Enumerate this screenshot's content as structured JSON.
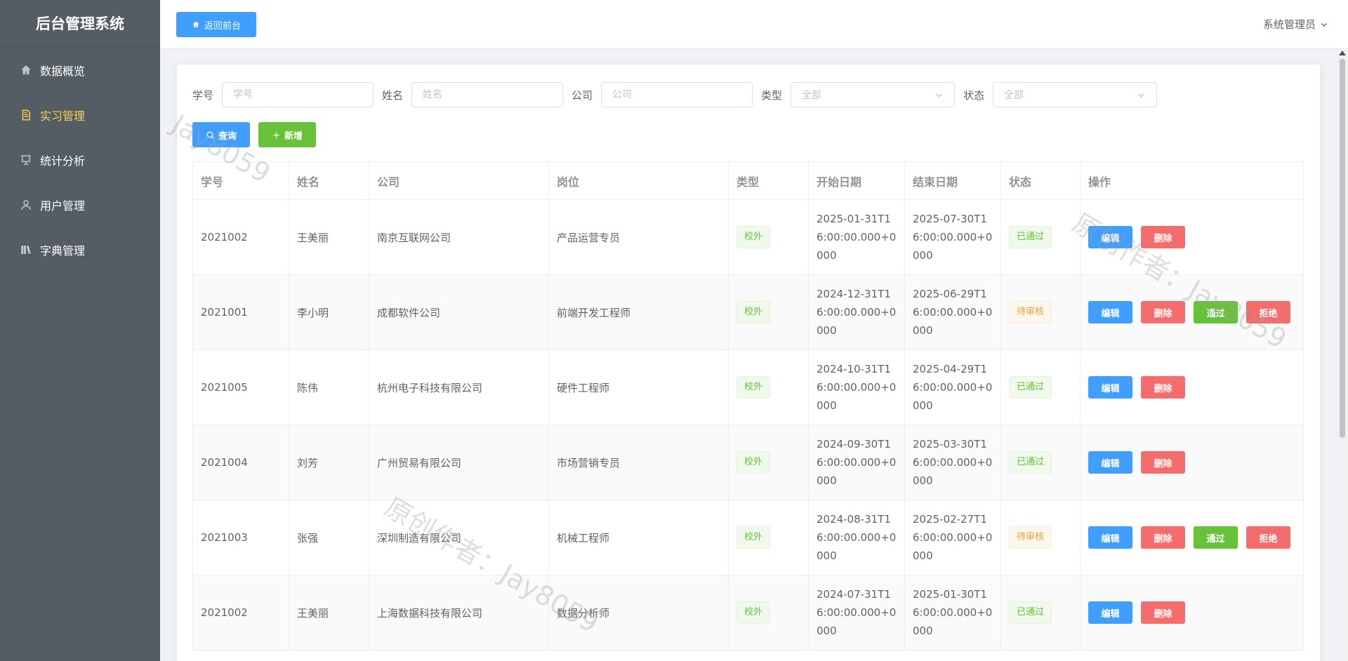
{
  "sidebar": {
    "title": "后台管理系统",
    "items": [
      {
        "label": "数据概览",
        "icon": "home-icon"
      },
      {
        "label": "实习管理",
        "icon": "document-icon",
        "active": true
      },
      {
        "label": "统计分析",
        "icon": "presentation-icon"
      },
      {
        "label": "用户管理",
        "icon": "user-icon"
      },
      {
        "label": "字典管理",
        "icon": "books-icon"
      }
    ]
  },
  "header": {
    "home_button": "返回前台",
    "user": "系统管理员"
  },
  "filters": {
    "student_id_label": "学号",
    "student_id_placeholder": "学号",
    "name_label": "姓名",
    "name_placeholder": "姓名",
    "company_label": "公司",
    "company_placeholder": "公司",
    "type_label": "类型",
    "type_value": "全部",
    "status_label": "状态",
    "status_value": "全部"
  },
  "actions": {
    "query": "查询",
    "add": "新增"
  },
  "table": {
    "columns": [
      "学号",
      "姓名",
      "公司",
      "岗位",
      "类型",
      "开始日期",
      "结束日期",
      "状态",
      "操作"
    ],
    "ops": {
      "edit": "编辑",
      "delete": "删除",
      "approve": "通过",
      "reject": "拒绝"
    },
    "rows": [
      {
        "id": "2021002",
        "name": "王美丽",
        "company": "南京互联网公司",
        "position": "产品运营专员",
        "type": "校外",
        "start": "2025-01-31T16:00:00.000+0000",
        "end": "2025-07-30T16:00:00.000+0000",
        "status": "已通过"
      },
      {
        "id": "2021001",
        "name": "李小明",
        "company": "成都软件公司",
        "position": "前端开发工程师",
        "type": "校外",
        "start": "2024-12-31T16:00:00.000+0000",
        "end": "2025-06-29T16:00:00.000+0000",
        "status": "待审核"
      },
      {
        "id": "2021005",
        "name": "陈伟",
        "company": "杭州电子科技有限公司",
        "position": "硬件工程师",
        "type": "校外",
        "start": "2024-10-31T16:00:00.000+0000",
        "end": "2025-04-29T16:00:00.000+0000",
        "status": "已通过"
      },
      {
        "id": "2021004",
        "name": "刘芳",
        "company": "广州贸易有限公司",
        "position": "市场营销专员",
        "type": "校外",
        "start": "2024-09-30T16:00:00.000+0000",
        "end": "2025-03-30T16:00:00.000+0000",
        "status": "已通过"
      },
      {
        "id": "2021003",
        "name": "张强",
        "company": "深圳制造有限公司",
        "position": "机械工程师",
        "type": "校外",
        "start": "2024-08-31T16:00:00.000+0000",
        "end": "2025-02-27T16:00:00.000+0000",
        "status": "待审核"
      },
      {
        "id": "2021002",
        "name": "王美丽",
        "company": "上海数据科技有限公司",
        "position": "数据分析师",
        "type": "校外",
        "start": "2024-07-31T16:00:00.000+0000",
        "end": "2025-01-30T16:00:00.000+0000",
        "status": "已通过"
      }
    ]
  },
  "watermark": "原创作者：Jay8059",
  "watermark_short": "Jay8059"
}
